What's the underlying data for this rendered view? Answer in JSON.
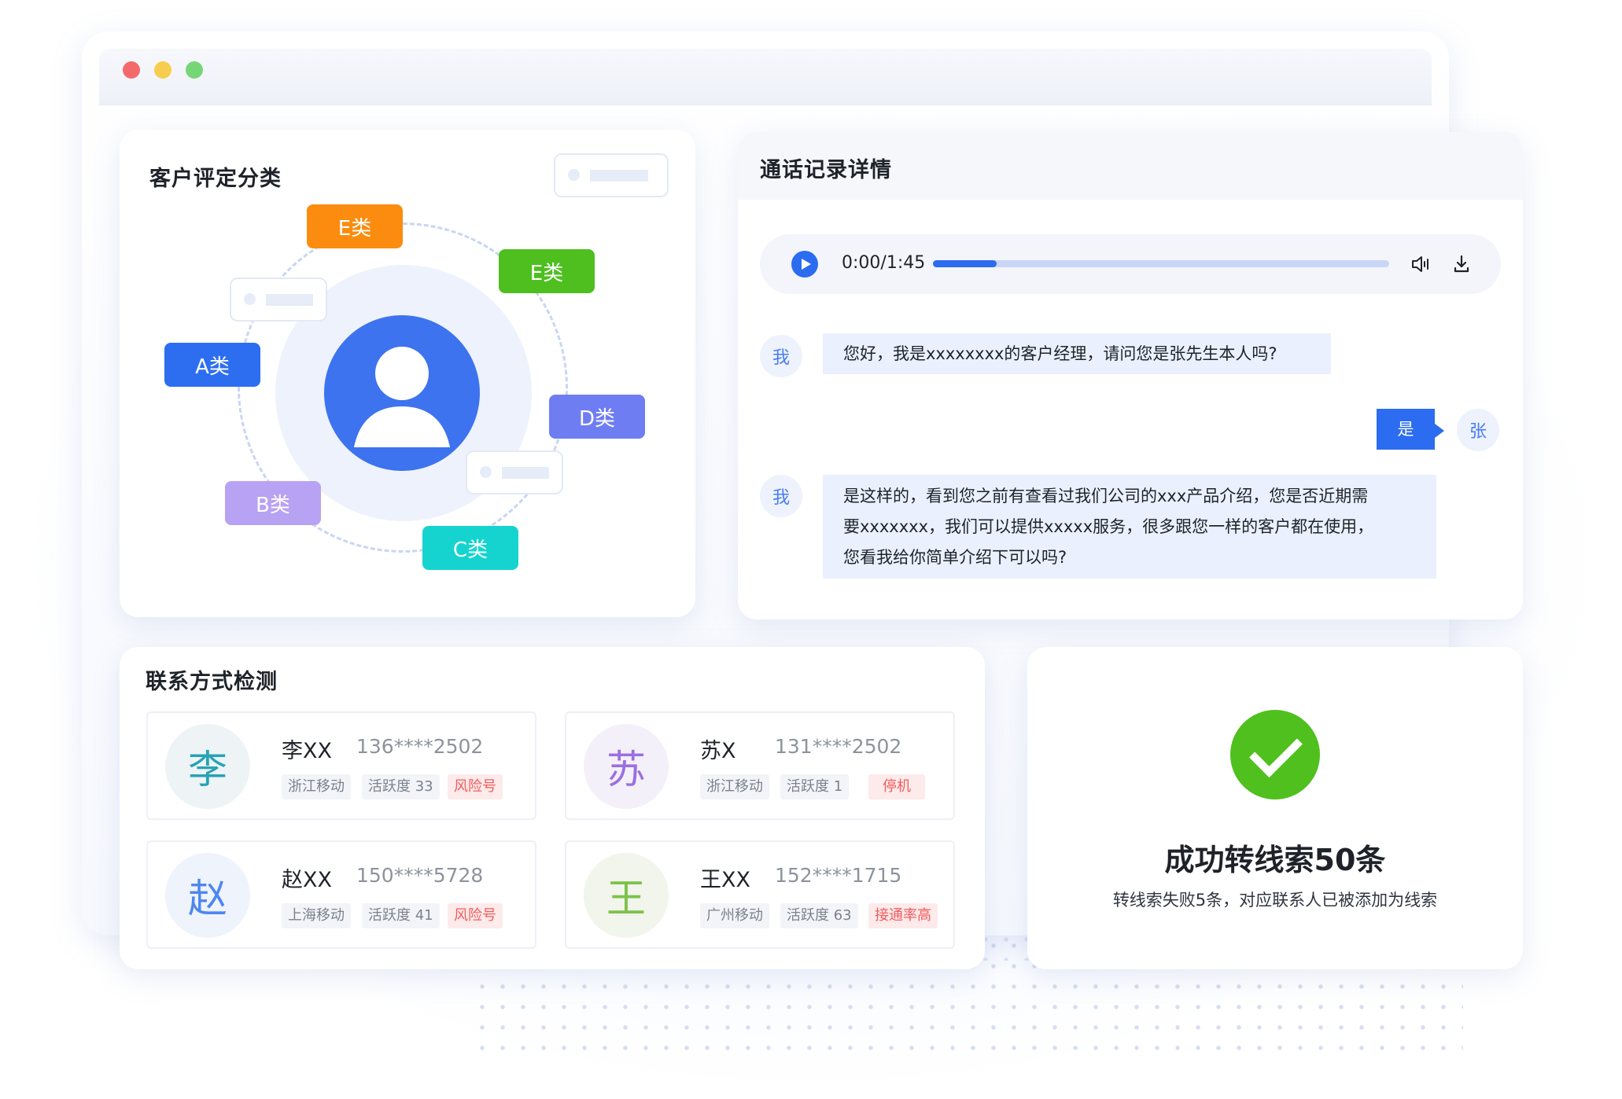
{
  "window": {
    "controls": [
      "close",
      "minimize",
      "maximize"
    ]
  },
  "classify": {
    "title": "客户评定分类",
    "badges": {
      "e_orange": "E类",
      "e_green": "E类",
      "a": "A类",
      "d": "D类",
      "b": "B类",
      "c": "C类"
    },
    "colors": {
      "orange": "#fb8c0f",
      "green": "#4fbf20",
      "blue": "#2d6ef1",
      "periwinkle": "#6f7df2",
      "lavender": "#b7a2f3",
      "cyan": "#15d4cf"
    }
  },
  "call": {
    "title": "通话记录详情",
    "player": {
      "time": "0:00/1:45",
      "progress": 0.14,
      "play_icon": "play-icon",
      "volume_icon": "volume-icon",
      "download_icon": "download-icon"
    },
    "messages": [
      {
        "speaker": "我",
        "text": "您好，我是xxxxxxxx的客户经理，请问您是张先生本人吗?"
      },
      {
        "speaker": "张",
        "text": "是"
      },
      {
        "speaker": "我",
        "lines": [
          "是这样的，看到您之前有查看过我们公司的xxx产品介绍，您是否近期需",
          "要xxxxxxx，我们可以提供xxxxx服务，很多跟您一样的客户都在使用，",
          "您看我给你简单介绍下可以吗?"
        ]
      }
    ]
  },
  "contacts": {
    "title": "联系方式检测",
    "items": [
      {
        "avatar": "李",
        "name": "李XX",
        "phone": "136****2502",
        "carrier": "浙江移动",
        "activity": "活跃度 33",
        "flag": "风险号",
        "avatar_color": "#27a3b4",
        "avatar_bg": "#eef3f5"
      },
      {
        "avatar": "苏",
        "name": "苏X",
        "phone": "131****2502",
        "carrier": "浙江移动",
        "activity": "活跃度 1",
        "flag": "停机",
        "avatar_color": "#9b6fe0",
        "avatar_bg": "#f3f0fa"
      },
      {
        "avatar": "赵",
        "name": "赵XX",
        "phone": "150****5728",
        "carrier": "上海移动",
        "activity": "活跃度 41",
        "flag": "风险号",
        "avatar_color": "#4d86f0",
        "avatar_bg": "#eef3fc"
      },
      {
        "avatar": "王",
        "name": "王XX",
        "phone": "152****1715",
        "carrier": "广州移动",
        "activity": "活跃度 63",
        "flag": "接通率高",
        "avatar_color": "#7cc24a",
        "avatar_bg": "#f1f5ec"
      }
    ]
  },
  "success": {
    "title": "成功转线索50条",
    "subtitle": "转线索失败5条，对应联系人已被添加为线索",
    "icon": "check-circle-icon"
  }
}
